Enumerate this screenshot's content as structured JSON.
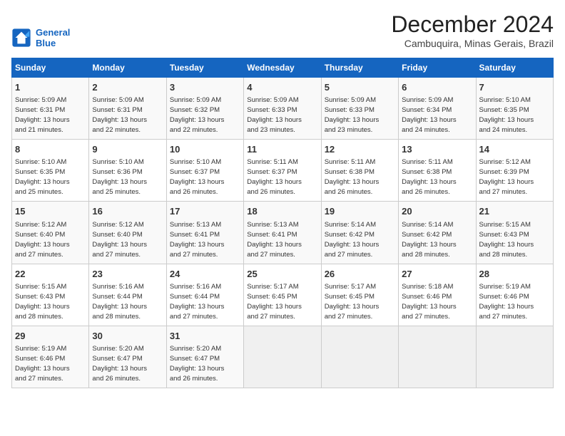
{
  "logo": {
    "line1": "General",
    "line2": "Blue"
  },
  "title": "December 2024",
  "location": "Cambuquira, Minas Gerais, Brazil",
  "days_of_week": [
    "Sunday",
    "Monday",
    "Tuesday",
    "Wednesday",
    "Thursday",
    "Friday",
    "Saturday"
  ],
  "weeks": [
    [
      {
        "day": 1,
        "info": "Sunrise: 5:09 AM\nSunset: 6:31 PM\nDaylight: 13 hours\nand 21 minutes."
      },
      {
        "day": 2,
        "info": "Sunrise: 5:09 AM\nSunset: 6:31 PM\nDaylight: 13 hours\nand 22 minutes."
      },
      {
        "day": 3,
        "info": "Sunrise: 5:09 AM\nSunset: 6:32 PM\nDaylight: 13 hours\nand 22 minutes."
      },
      {
        "day": 4,
        "info": "Sunrise: 5:09 AM\nSunset: 6:33 PM\nDaylight: 13 hours\nand 23 minutes."
      },
      {
        "day": 5,
        "info": "Sunrise: 5:09 AM\nSunset: 6:33 PM\nDaylight: 13 hours\nand 23 minutes."
      },
      {
        "day": 6,
        "info": "Sunrise: 5:09 AM\nSunset: 6:34 PM\nDaylight: 13 hours\nand 24 minutes."
      },
      {
        "day": 7,
        "info": "Sunrise: 5:10 AM\nSunset: 6:35 PM\nDaylight: 13 hours\nand 24 minutes."
      }
    ],
    [
      {
        "day": 8,
        "info": "Sunrise: 5:10 AM\nSunset: 6:35 PM\nDaylight: 13 hours\nand 25 minutes."
      },
      {
        "day": 9,
        "info": "Sunrise: 5:10 AM\nSunset: 6:36 PM\nDaylight: 13 hours\nand 25 minutes."
      },
      {
        "day": 10,
        "info": "Sunrise: 5:10 AM\nSunset: 6:37 PM\nDaylight: 13 hours\nand 26 minutes."
      },
      {
        "day": 11,
        "info": "Sunrise: 5:11 AM\nSunset: 6:37 PM\nDaylight: 13 hours\nand 26 minutes."
      },
      {
        "day": 12,
        "info": "Sunrise: 5:11 AM\nSunset: 6:38 PM\nDaylight: 13 hours\nand 26 minutes."
      },
      {
        "day": 13,
        "info": "Sunrise: 5:11 AM\nSunset: 6:38 PM\nDaylight: 13 hours\nand 26 minutes."
      },
      {
        "day": 14,
        "info": "Sunrise: 5:12 AM\nSunset: 6:39 PM\nDaylight: 13 hours\nand 27 minutes."
      }
    ],
    [
      {
        "day": 15,
        "info": "Sunrise: 5:12 AM\nSunset: 6:40 PM\nDaylight: 13 hours\nand 27 minutes."
      },
      {
        "day": 16,
        "info": "Sunrise: 5:12 AM\nSunset: 6:40 PM\nDaylight: 13 hours\nand 27 minutes."
      },
      {
        "day": 17,
        "info": "Sunrise: 5:13 AM\nSunset: 6:41 PM\nDaylight: 13 hours\nand 27 minutes."
      },
      {
        "day": 18,
        "info": "Sunrise: 5:13 AM\nSunset: 6:41 PM\nDaylight: 13 hours\nand 27 minutes."
      },
      {
        "day": 19,
        "info": "Sunrise: 5:14 AM\nSunset: 6:42 PM\nDaylight: 13 hours\nand 27 minutes."
      },
      {
        "day": 20,
        "info": "Sunrise: 5:14 AM\nSunset: 6:42 PM\nDaylight: 13 hours\nand 28 minutes."
      },
      {
        "day": 21,
        "info": "Sunrise: 5:15 AM\nSunset: 6:43 PM\nDaylight: 13 hours\nand 28 minutes."
      }
    ],
    [
      {
        "day": 22,
        "info": "Sunrise: 5:15 AM\nSunset: 6:43 PM\nDaylight: 13 hours\nand 28 minutes."
      },
      {
        "day": 23,
        "info": "Sunrise: 5:16 AM\nSunset: 6:44 PM\nDaylight: 13 hours\nand 28 minutes."
      },
      {
        "day": 24,
        "info": "Sunrise: 5:16 AM\nSunset: 6:44 PM\nDaylight: 13 hours\nand 27 minutes."
      },
      {
        "day": 25,
        "info": "Sunrise: 5:17 AM\nSunset: 6:45 PM\nDaylight: 13 hours\nand 27 minutes."
      },
      {
        "day": 26,
        "info": "Sunrise: 5:17 AM\nSunset: 6:45 PM\nDaylight: 13 hours\nand 27 minutes."
      },
      {
        "day": 27,
        "info": "Sunrise: 5:18 AM\nSunset: 6:46 PM\nDaylight: 13 hours\nand 27 minutes."
      },
      {
        "day": 28,
        "info": "Sunrise: 5:19 AM\nSunset: 6:46 PM\nDaylight: 13 hours\nand 27 minutes."
      }
    ],
    [
      {
        "day": 29,
        "info": "Sunrise: 5:19 AM\nSunset: 6:46 PM\nDaylight: 13 hours\nand 27 minutes."
      },
      {
        "day": 30,
        "info": "Sunrise: 5:20 AM\nSunset: 6:47 PM\nDaylight: 13 hours\nand 26 minutes."
      },
      {
        "day": 31,
        "info": "Sunrise: 5:20 AM\nSunset: 6:47 PM\nDaylight: 13 hours\nand 26 minutes."
      },
      null,
      null,
      null,
      null
    ]
  ]
}
